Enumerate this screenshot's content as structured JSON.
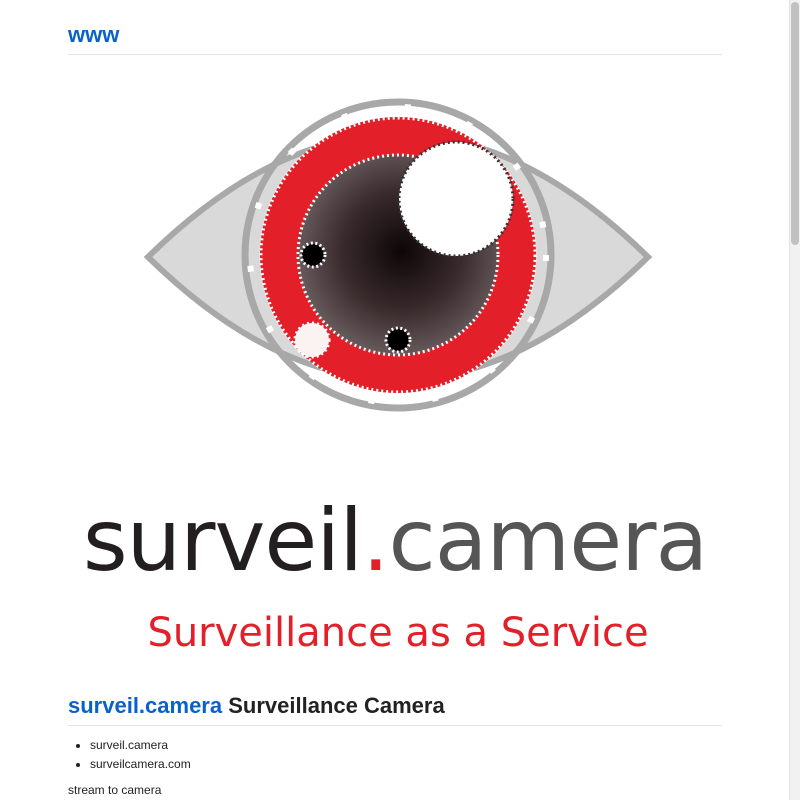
{
  "header": {
    "site_title": "www"
  },
  "logo": {
    "wordmark_left": "surveil",
    "wordmark_dot": ".",
    "wordmark_right": "camera",
    "tagline": "Surveillance as a Service",
    "colors": {
      "red": "#e3202a",
      "dark": "#231f20",
      "gray_text": "#555555",
      "eye_gray": "#d9d9d9",
      "eye_outline": "#a8a8a8"
    }
  },
  "article": {
    "heading_link": "surveil.camera",
    "heading_rest": " Surveillance Camera",
    "domains": [
      "surveil.camera",
      "surveilcamera.com"
    ],
    "intro_text": "stream to camera"
  },
  "colors": {
    "link": "#0a62c9",
    "text": "#222222"
  }
}
